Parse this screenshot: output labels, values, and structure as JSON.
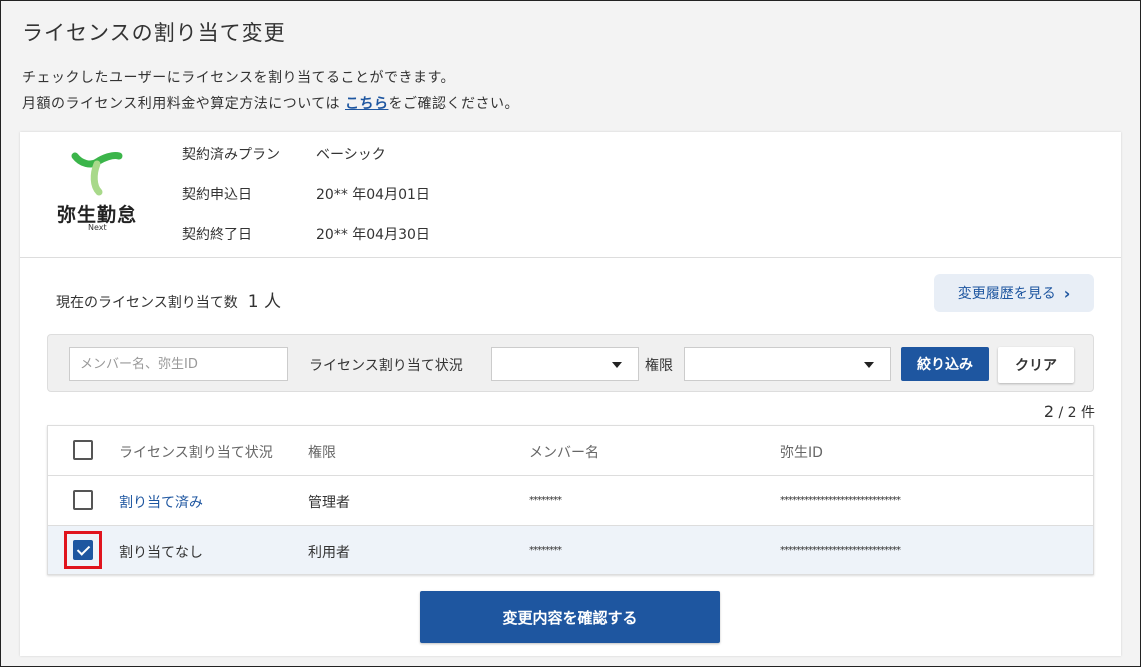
{
  "page": {
    "title": "ライセンスの割り当て変更",
    "description_line1": "チェックしたユーザーにライセンスを割り当てることができます。",
    "description_line2_prefix": "月額のライセンス利用料金や算定方法については ",
    "description_link": "こちら",
    "description_line2_suffix": "をご確認ください。"
  },
  "product": {
    "name": "弥生勤怠",
    "sub": "Next"
  },
  "plan": {
    "plan_label": "契約済みプラン",
    "plan_value": "ベーシック",
    "apply_label": "契約申込日",
    "apply_value": "20** 年04月01日",
    "end_label": "契約終了日",
    "end_value": "20** 年04月30日"
  },
  "license": {
    "count_label": "現在のライセンス割り当て数",
    "count_value": "1 人",
    "history_button": "変更履歴を見る"
  },
  "filter": {
    "search_placeholder": "メンバー名、弥生ID",
    "status_label": "ライセンス割り当て状況",
    "status_value": "",
    "role_label": "権限",
    "role_value": "",
    "filter_button": "絞り込み",
    "clear_button": "クリア"
  },
  "pager": {
    "shown": "2",
    "total": "/ 2 件"
  },
  "table": {
    "headers": {
      "status": "ライセンス割り当て状況",
      "role": "権限",
      "name": "メンバー名",
      "id": "弥生ID"
    },
    "rows": [
      {
        "checked": false,
        "status": "割り当て済み",
        "role": "管理者",
        "name": "********",
        "id": "******************************"
      },
      {
        "checked": true,
        "status": "割り当てなし",
        "role": "利用者",
        "name": "********",
        "id": "******************************"
      }
    ]
  },
  "confirm_button": "変更内容を確認する",
  "colors": {
    "primary": "#1e56a0",
    "highlight": "#e0141e",
    "logo_green": "#3bb54a",
    "logo_light_green": "#a8d98a"
  }
}
